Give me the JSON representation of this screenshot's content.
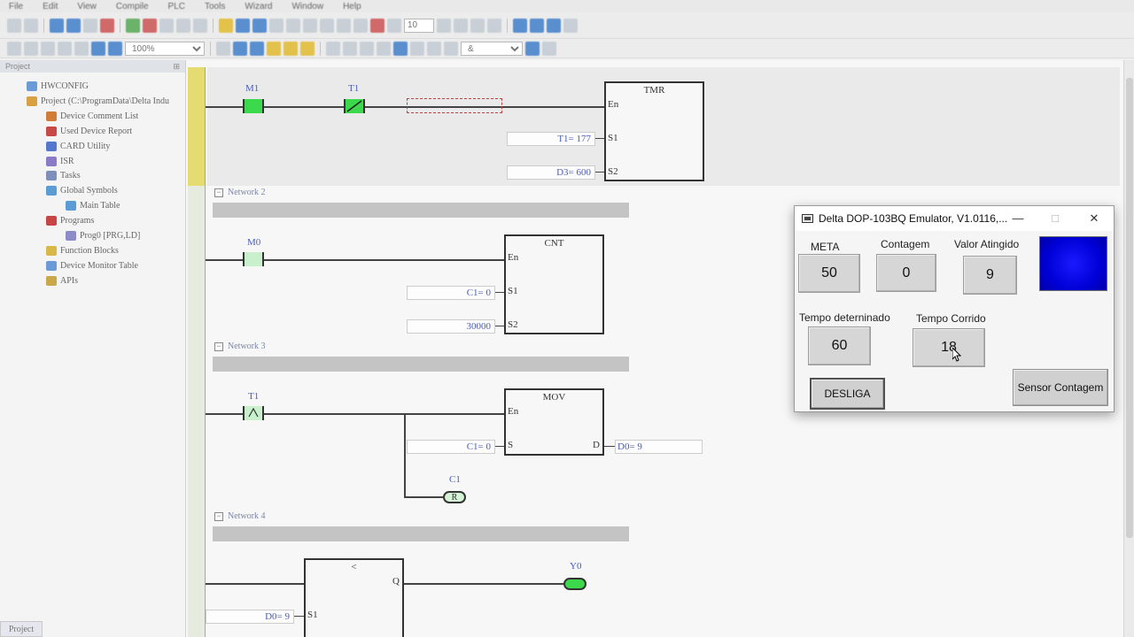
{
  "menu": [
    "File",
    "Edit",
    "View",
    "Compile",
    "PLC",
    "Tools",
    "Wizard",
    "Window",
    "Help"
  ],
  "toolbar": {
    "scan_value": "10",
    "zoom_value": "100%",
    "operator_select": "&"
  },
  "project_panel": {
    "title": "Project",
    "tab_label": "Project",
    "items": [
      {
        "label": "HWCONFIG",
        "indent": 0,
        "color": "#6a9bd6"
      },
      {
        "label": "Project (C:\\ProgramData\\Delta Indu",
        "indent": 0,
        "color": "#d8a040"
      },
      {
        "label": "Device Comment List",
        "indent": 1,
        "color": "#d07d3a"
      },
      {
        "label": "Used Device Report",
        "indent": 1,
        "color": "#c84848"
      },
      {
        "label": "CARD Utility",
        "indent": 1,
        "color": "#5577cc"
      },
      {
        "label": "ISR",
        "indent": 1,
        "color": "#8a7ac8"
      },
      {
        "label": "Tasks",
        "indent": 1,
        "color": "#7b8fb8"
      },
      {
        "label": "Global Symbols",
        "indent": 1,
        "color": "#5b9bd6"
      },
      {
        "label": "Main Table",
        "indent": 2,
        "color": "#5b9bd6"
      },
      {
        "label": "Programs",
        "indent": 1,
        "color": "#c74545"
      },
      {
        "label": "Prog0 [PRG,LD]",
        "indent": 2,
        "color": "#8c8cc8"
      },
      {
        "label": "Function Blocks",
        "indent": 1,
        "color": "#d8b848"
      },
      {
        "label": "Device Monitor Table",
        "indent": 1,
        "color": "#6a9bd6"
      },
      {
        "label": "APIs",
        "indent": 1,
        "color": "#c8a848"
      }
    ]
  },
  "ladder": {
    "network1": {
      "contact1": "M1",
      "contact2": "T1",
      "block": "TMR",
      "pin_en": "En",
      "pin_s1": "S1",
      "pin_s2": "S2",
      "s1_value": "T1= 177",
      "s2_value": "D3= 600"
    },
    "network2": {
      "header": "Network 2",
      "contact1": "M0",
      "block": "CNT",
      "pin_en": "En",
      "pin_s1": "S1",
      "pin_s2": "S2",
      "s1_value": "C1= 0",
      "s2_value": "30000"
    },
    "network3": {
      "header": "Network 3",
      "contact1": "T1",
      "block": "MOV",
      "pin_en": "En",
      "pin_s": "S",
      "pin_d": "D",
      "s_value": "C1= 0",
      "d_value": "D0= 9",
      "coil_label": "C1",
      "coil_text": "R"
    },
    "network4": {
      "header": "Network 4",
      "block": "<",
      "pin_q": "Q",
      "pin_s1": "S1",
      "s1_value": "D0= 9",
      "coil_label": "Y0"
    }
  },
  "emulator": {
    "title": "Delta DOP-103BQ Emulator, V1.0116,...",
    "controls": {
      "minimize": "—",
      "maximize": "□",
      "close": "✕"
    },
    "meta_label": "META",
    "meta_value": "50",
    "contagem_label": "Contagem",
    "contagem_value": "0",
    "valor_label": "Valor Atingido",
    "valor_value": "9",
    "tempo_det_label": "Tempo deterninado",
    "tempo_det_value": "60",
    "tempo_corrido_label": "Tempo Corrido",
    "tempo_corrido_value": "18",
    "desliga_label": "DESLIGA",
    "sensor_label": "Sensor Contagem",
    "lamp_color": "#0000e0"
  },
  "colors": {
    "contact_on": "#3bd94b",
    "label_blue": "#4a5db5",
    "network_header": "#7a86a8"
  }
}
